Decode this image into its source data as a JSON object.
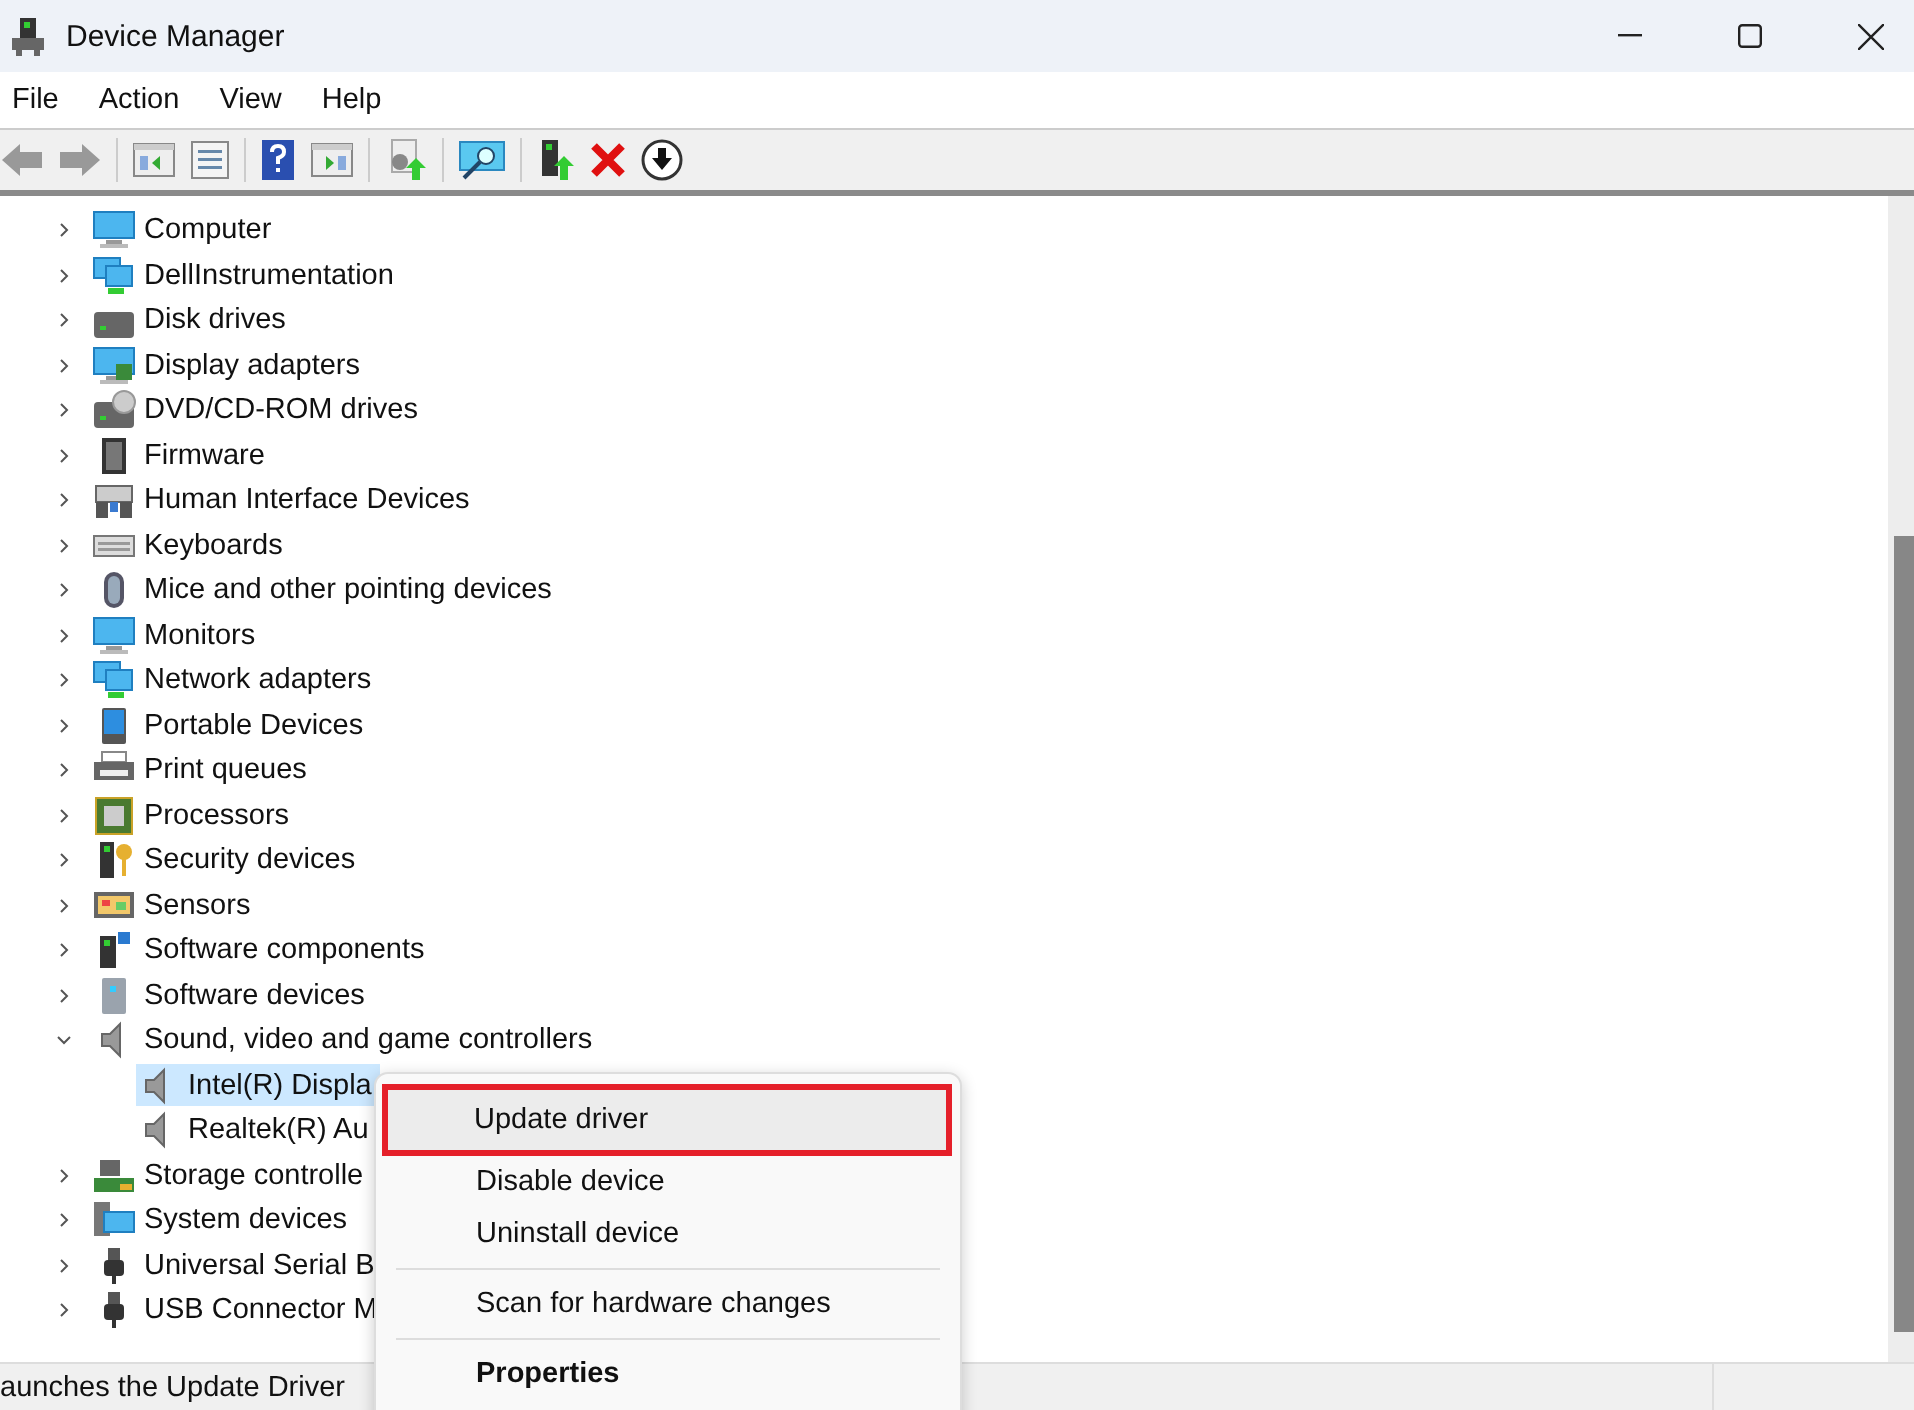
{
  "window": {
    "title": "Device Manager"
  },
  "menu": [
    "File",
    "Action",
    "View",
    "Help"
  ],
  "tree": [
    {
      "label": "Computer",
      "expanded": false
    },
    {
      "label": "DellInstrumentation",
      "expanded": false
    },
    {
      "label": "Disk drives",
      "expanded": false
    },
    {
      "label": "Display adapters",
      "expanded": false
    },
    {
      "label": "DVD/CD-ROM drives",
      "expanded": false
    },
    {
      "label": "Firmware",
      "expanded": false
    },
    {
      "label": "Human Interface Devices",
      "expanded": false
    },
    {
      "label": "Keyboards",
      "expanded": false
    },
    {
      "label": "Mice and other pointing devices",
      "expanded": false
    },
    {
      "label": "Monitors",
      "expanded": false
    },
    {
      "label": "Network adapters",
      "expanded": false
    },
    {
      "label": "Portable Devices",
      "expanded": false
    },
    {
      "label": "Print queues",
      "expanded": false
    },
    {
      "label": "Processors",
      "expanded": false
    },
    {
      "label": "Security devices",
      "expanded": false
    },
    {
      "label": "Sensors",
      "expanded": false
    },
    {
      "label": "Software components",
      "expanded": false
    },
    {
      "label": "Software devices",
      "expanded": false
    },
    {
      "label": "Sound, video and game controllers",
      "expanded": true,
      "children": [
        {
          "label": "Intel(R) Displa",
          "selected": true
        },
        {
          "label": "Realtek(R) Au",
          "selected": false
        }
      ]
    },
    {
      "label": "Storage controlle",
      "expanded": false
    },
    {
      "label": "System devices",
      "expanded": false
    },
    {
      "label": "Universal Serial B",
      "expanded": false
    },
    {
      "label": "USB Connector M",
      "expanded": false
    }
  ],
  "context_menu": [
    [
      {
        "label": "Update driver",
        "selected": true
      },
      {
        "label": "Disable device",
        "selected": false
      },
      {
        "label": "Uninstall device",
        "selected": false
      }
    ],
    [
      {
        "label": "Scan for hardware changes",
        "selected": false
      }
    ],
    [
      {
        "label": "Properties",
        "selected": false,
        "kind": "default"
      }
    ]
  ],
  "status_bar": "aunches the Update Driver"
}
